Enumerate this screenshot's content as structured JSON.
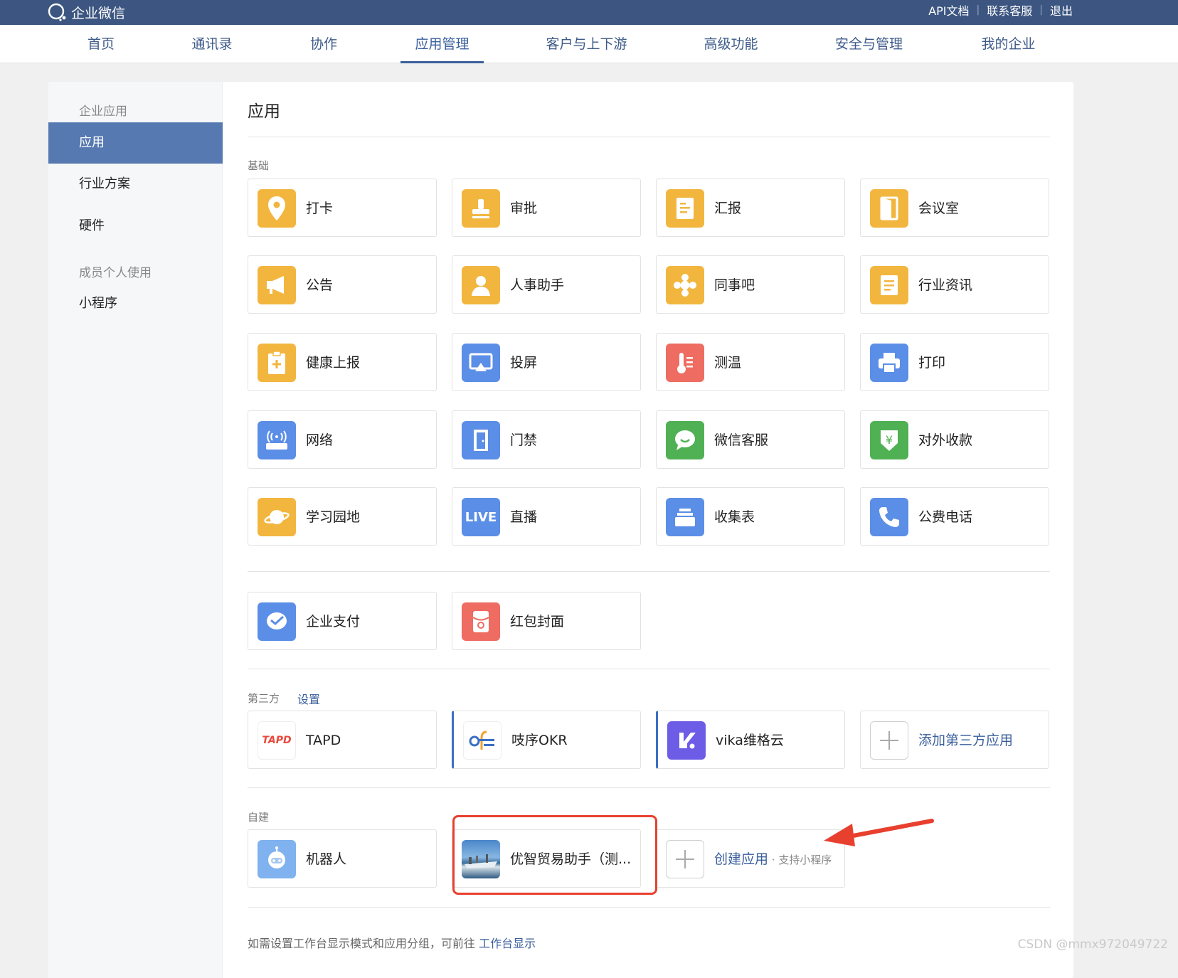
{
  "topbar": {
    "logo_text": "企业微信",
    "links": [
      "API文档",
      "联系客服",
      "退出"
    ]
  },
  "nav": {
    "items": [
      "首页",
      "通讯录",
      "协作",
      "应用管理",
      "客户与上下游",
      "高级功能",
      "安全与管理",
      "我的企业"
    ],
    "active": "应用管理"
  },
  "sidebar": {
    "section1": "企业应用",
    "items1": [
      "应用",
      "行业方案",
      "硬件"
    ],
    "section2": "成员个人使用",
    "items2": [
      "小程序"
    ]
  },
  "main": {
    "title": "应用",
    "basic_label": "基础",
    "basic_apps": [
      {
        "name": "打卡",
        "icon": "location-pin-icon",
        "color": "#f2b63f"
      },
      {
        "name": "审批",
        "icon": "stamp-icon",
        "color": "#f2b63f"
      },
      {
        "name": "汇报",
        "icon": "report-icon",
        "color": "#f2b63f"
      },
      {
        "name": "会议室",
        "icon": "door-icon",
        "color": "#f2b63f"
      },
      {
        "name": "公告",
        "icon": "megaphone-icon",
        "color": "#f2b63f"
      },
      {
        "name": "人事助手",
        "icon": "person-icon",
        "color": "#f2b63f"
      },
      {
        "name": "同事吧",
        "icon": "community-icon",
        "color": "#f2b63f"
      },
      {
        "name": "行业资讯",
        "icon": "news-icon",
        "color": "#f2b63f"
      },
      {
        "name": "健康上报",
        "icon": "health-clipboard-icon",
        "color": "#f2b63f"
      },
      {
        "name": "投屏",
        "icon": "screen-cast-icon",
        "color": "#5b8ee6"
      },
      {
        "name": "测温",
        "icon": "thermometer-icon",
        "color": "#ee6c61"
      },
      {
        "name": "打印",
        "icon": "printer-icon",
        "color": "#5b8ee6"
      },
      {
        "name": "网络",
        "icon": "router-icon",
        "color": "#5b8ee6"
      },
      {
        "name": "门禁",
        "icon": "access-door-icon",
        "color": "#5b8ee6"
      },
      {
        "name": "微信客服",
        "icon": "chat-bubble-icon",
        "color": "#4fb153"
      },
      {
        "name": "对外收款",
        "icon": "yuan-shield-icon",
        "color": "#4fb153"
      },
      {
        "name": "学习园地",
        "icon": "planet-icon",
        "color": "#f2b63f"
      },
      {
        "name": "直播",
        "icon": "live-icon",
        "color": "#5b8ee6",
        "badge": "LIVE"
      },
      {
        "name": "收集表",
        "icon": "tray-icon",
        "color": "#5b8ee6"
      },
      {
        "name": "公费电话",
        "icon": "phone-icon",
        "color": "#5b8ee6"
      }
    ],
    "pay_apps": [
      {
        "name": "企业支付",
        "icon": "pay-icon",
        "color": "#5b8ee6"
      },
      {
        "name": "红包封面",
        "icon": "red-envelope-icon",
        "color": "#ee6c61"
      }
    ],
    "third_label": "第三方",
    "third_setting": "设置",
    "third_apps": [
      {
        "name": "TAPD",
        "icon": "tapd-logo-icon",
        "badge": "TAPD"
      },
      {
        "name": "吱序OKR",
        "icon": "okr-logo-icon"
      },
      {
        "name": "vika维格云",
        "icon": "vika-logo-icon",
        "color": "#6d5ce6"
      }
    ],
    "third_add": "添加第三方应用",
    "custom_label": "自建",
    "custom_apps": [
      {
        "name": "机器人",
        "icon": "robot-icon"
      },
      {
        "name": "优智贸易助手（测...",
        "icon": "ship-photo-icon"
      }
    ],
    "create_app": "创建应用",
    "create_sub": " · 支持小程序",
    "note_text": "如需设置工作台显示模式和应用分组，可前往 ",
    "note_link": "工作台显示"
  },
  "watermark": "CSDN @mmx972049722"
}
